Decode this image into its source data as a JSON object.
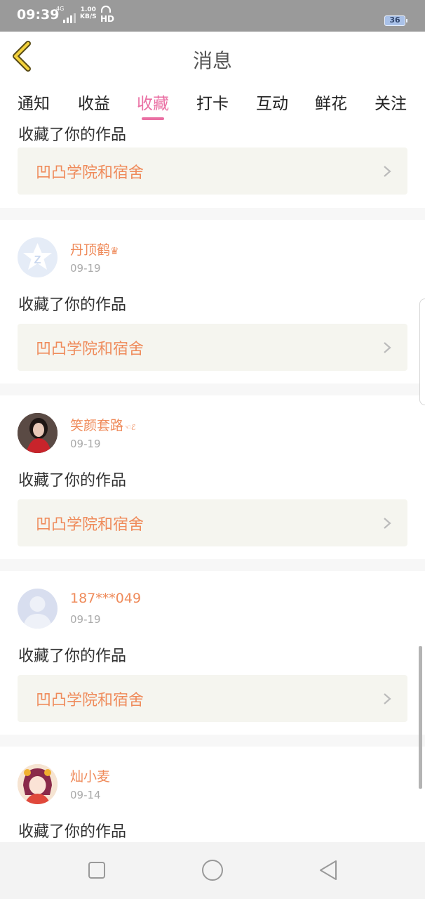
{
  "status_bar": {
    "time": "09:39",
    "network_small": "4G",
    "speed_value": "1.00",
    "speed_unit": "KB/S",
    "hd": "HD",
    "battery": "36"
  },
  "header": {
    "title": "消息",
    "back_icon": "chevron-left-icon"
  },
  "tabs": [
    {
      "label": "通知",
      "active": false
    },
    {
      "label": "收益",
      "active": false
    },
    {
      "label": "收藏",
      "active": true
    },
    {
      "label": "打卡",
      "active": false
    },
    {
      "label": "互动",
      "active": false
    },
    {
      "label": "鲜花",
      "active": false
    },
    {
      "label": "关注",
      "active": false
    }
  ],
  "feed": {
    "partial_item": {
      "action_text": "收藏了你的作品",
      "work_title": "凹凸学院和宿舍"
    },
    "items": [
      {
        "username": "丹顶鹤",
        "badge": "♛",
        "date": "09-19",
        "action_text": "收藏了你的作品",
        "work_title": "凹凸学院和宿舍",
        "avatar": "qzone-star-avatar"
      },
      {
        "username": "笑颜套路",
        "badge": "☜ℰ",
        "date": "09-19",
        "action_text": "收藏了你的作品",
        "work_title": "凹凸学院和宿舍",
        "avatar": "girl-photo-avatar"
      },
      {
        "username": "187***049",
        "badge": "",
        "date": "09-19",
        "action_text": "收藏了你的作品",
        "work_title": "凹凸学院和宿舍",
        "avatar": "default-user-avatar"
      },
      {
        "username": "灿小麦",
        "badge": "",
        "date": "09-14",
        "action_text": "收藏了你的作品",
        "work_title": "",
        "avatar": "anime-girl-avatar"
      }
    ]
  },
  "colors": {
    "accent_pink": "#ea6fa3",
    "accent_orange": "#ef8b5b",
    "link_background": "#f5f5ef"
  }
}
